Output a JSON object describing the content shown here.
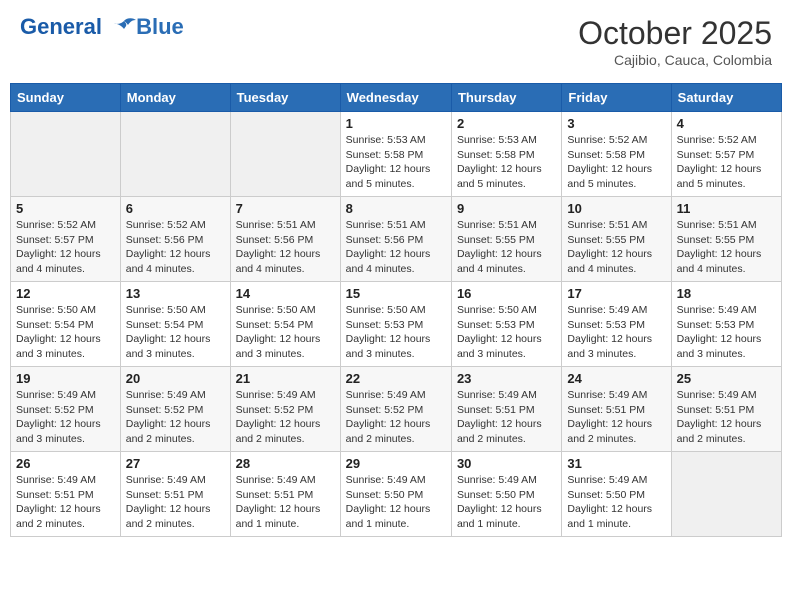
{
  "header": {
    "logo_line1": "General",
    "logo_line2": "Blue",
    "month_title": "October 2025",
    "location": "Cajibio, Cauca, Colombia"
  },
  "weekdays": [
    "Sunday",
    "Monday",
    "Tuesday",
    "Wednesday",
    "Thursday",
    "Friday",
    "Saturday"
  ],
  "weeks": [
    [
      {
        "day": "",
        "info": ""
      },
      {
        "day": "",
        "info": ""
      },
      {
        "day": "",
        "info": ""
      },
      {
        "day": "1",
        "info": "Sunrise: 5:53 AM\nSunset: 5:58 PM\nDaylight: 12 hours\nand 5 minutes."
      },
      {
        "day": "2",
        "info": "Sunrise: 5:53 AM\nSunset: 5:58 PM\nDaylight: 12 hours\nand 5 minutes."
      },
      {
        "day": "3",
        "info": "Sunrise: 5:52 AM\nSunset: 5:58 PM\nDaylight: 12 hours\nand 5 minutes."
      },
      {
        "day": "4",
        "info": "Sunrise: 5:52 AM\nSunset: 5:57 PM\nDaylight: 12 hours\nand 5 minutes."
      }
    ],
    [
      {
        "day": "5",
        "info": "Sunrise: 5:52 AM\nSunset: 5:57 PM\nDaylight: 12 hours\nand 4 minutes."
      },
      {
        "day": "6",
        "info": "Sunrise: 5:52 AM\nSunset: 5:56 PM\nDaylight: 12 hours\nand 4 minutes."
      },
      {
        "day": "7",
        "info": "Sunrise: 5:51 AM\nSunset: 5:56 PM\nDaylight: 12 hours\nand 4 minutes."
      },
      {
        "day": "8",
        "info": "Sunrise: 5:51 AM\nSunset: 5:56 PM\nDaylight: 12 hours\nand 4 minutes."
      },
      {
        "day": "9",
        "info": "Sunrise: 5:51 AM\nSunset: 5:55 PM\nDaylight: 12 hours\nand 4 minutes."
      },
      {
        "day": "10",
        "info": "Sunrise: 5:51 AM\nSunset: 5:55 PM\nDaylight: 12 hours\nand 4 minutes."
      },
      {
        "day": "11",
        "info": "Sunrise: 5:51 AM\nSunset: 5:55 PM\nDaylight: 12 hours\nand 4 minutes."
      }
    ],
    [
      {
        "day": "12",
        "info": "Sunrise: 5:50 AM\nSunset: 5:54 PM\nDaylight: 12 hours\nand 3 minutes."
      },
      {
        "day": "13",
        "info": "Sunrise: 5:50 AM\nSunset: 5:54 PM\nDaylight: 12 hours\nand 3 minutes."
      },
      {
        "day": "14",
        "info": "Sunrise: 5:50 AM\nSunset: 5:54 PM\nDaylight: 12 hours\nand 3 minutes."
      },
      {
        "day": "15",
        "info": "Sunrise: 5:50 AM\nSunset: 5:53 PM\nDaylight: 12 hours\nand 3 minutes."
      },
      {
        "day": "16",
        "info": "Sunrise: 5:50 AM\nSunset: 5:53 PM\nDaylight: 12 hours\nand 3 minutes."
      },
      {
        "day": "17",
        "info": "Sunrise: 5:49 AM\nSunset: 5:53 PM\nDaylight: 12 hours\nand 3 minutes."
      },
      {
        "day": "18",
        "info": "Sunrise: 5:49 AM\nSunset: 5:53 PM\nDaylight: 12 hours\nand 3 minutes."
      }
    ],
    [
      {
        "day": "19",
        "info": "Sunrise: 5:49 AM\nSunset: 5:52 PM\nDaylight: 12 hours\nand 3 minutes."
      },
      {
        "day": "20",
        "info": "Sunrise: 5:49 AM\nSunset: 5:52 PM\nDaylight: 12 hours\nand 2 minutes."
      },
      {
        "day": "21",
        "info": "Sunrise: 5:49 AM\nSunset: 5:52 PM\nDaylight: 12 hours\nand 2 minutes."
      },
      {
        "day": "22",
        "info": "Sunrise: 5:49 AM\nSunset: 5:52 PM\nDaylight: 12 hours\nand 2 minutes."
      },
      {
        "day": "23",
        "info": "Sunrise: 5:49 AM\nSunset: 5:51 PM\nDaylight: 12 hours\nand 2 minutes."
      },
      {
        "day": "24",
        "info": "Sunrise: 5:49 AM\nSunset: 5:51 PM\nDaylight: 12 hours\nand 2 minutes."
      },
      {
        "day": "25",
        "info": "Sunrise: 5:49 AM\nSunset: 5:51 PM\nDaylight: 12 hours\nand 2 minutes."
      }
    ],
    [
      {
        "day": "26",
        "info": "Sunrise: 5:49 AM\nSunset: 5:51 PM\nDaylight: 12 hours\nand 2 minutes."
      },
      {
        "day": "27",
        "info": "Sunrise: 5:49 AM\nSunset: 5:51 PM\nDaylight: 12 hours\nand 2 minutes."
      },
      {
        "day": "28",
        "info": "Sunrise: 5:49 AM\nSunset: 5:51 PM\nDaylight: 12 hours\nand 1 minute."
      },
      {
        "day": "29",
        "info": "Sunrise: 5:49 AM\nSunset: 5:50 PM\nDaylight: 12 hours\nand 1 minute."
      },
      {
        "day": "30",
        "info": "Sunrise: 5:49 AM\nSunset: 5:50 PM\nDaylight: 12 hours\nand 1 minute."
      },
      {
        "day": "31",
        "info": "Sunrise: 5:49 AM\nSunset: 5:50 PM\nDaylight: 12 hours\nand 1 minute."
      },
      {
        "day": "",
        "info": ""
      }
    ]
  ]
}
